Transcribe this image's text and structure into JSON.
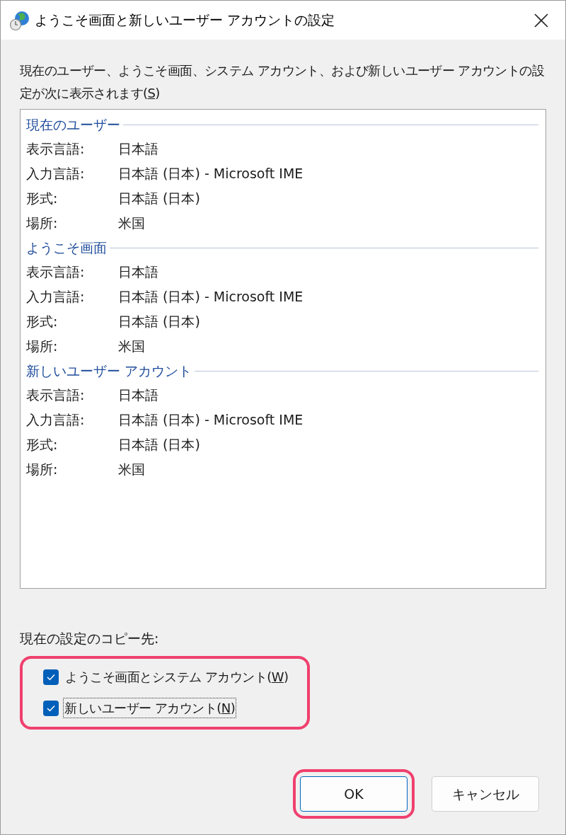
{
  "window": {
    "title": "ようこそ画面と新しいユーザー アカウントの設定"
  },
  "description": {
    "text_before": "現在のユーザー、ようこそ画面、システム アカウント、および新しいユーザー アカウントの設定が次に表示されます(",
    "access_key": "S",
    "text_after": ")"
  },
  "settings_list": [
    {
      "heading": "現在のユーザー",
      "rows": [
        {
          "label": "表示言語:",
          "value": "日本語"
        },
        {
          "label": "入力言語:",
          "value": "日本語 (日本) - Microsoft IME"
        },
        {
          "label": "形式:",
          "value": "日本語 (日本)"
        },
        {
          "label": "場所:",
          "value": "米国"
        }
      ]
    },
    {
      "heading": "ようこそ画面",
      "rows": [
        {
          "label": "表示言語:",
          "value": "日本語"
        },
        {
          "label": "入力言語:",
          "value": "日本語 (日本) - Microsoft IME"
        },
        {
          "label": "形式:",
          "value": "日本語 (日本)"
        },
        {
          "label": "場所:",
          "value": "米国"
        }
      ]
    },
    {
      "heading": "新しいユーザー アカウント",
      "rows": [
        {
          "label": "表示言語:",
          "value": "日本語"
        },
        {
          "label": "入力言語:",
          "value": "日本語 (日本) - Microsoft IME"
        },
        {
          "label": "形式:",
          "value": "日本語 (日本)"
        },
        {
          "label": "場所:",
          "value": "米国"
        }
      ]
    }
  ],
  "copy_to": {
    "label": "現在の設定のコピー先:",
    "highlighted": true,
    "checkboxes": [
      {
        "text_before": "ようこそ画面とシステム アカウント(",
        "access_key": "W",
        "text_after": ")",
        "checked": true,
        "focused": false
      },
      {
        "text_before": "新しいユーザー アカウント(",
        "access_key": "N",
        "text_after": ")",
        "checked": true,
        "focused": true
      }
    ]
  },
  "buttons": [
    {
      "label": "OK",
      "default": true,
      "highlighted": true
    },
    {
      "label": "キャンセル",
      "default": false,
      "highlighted": false
    }
  ]
}
